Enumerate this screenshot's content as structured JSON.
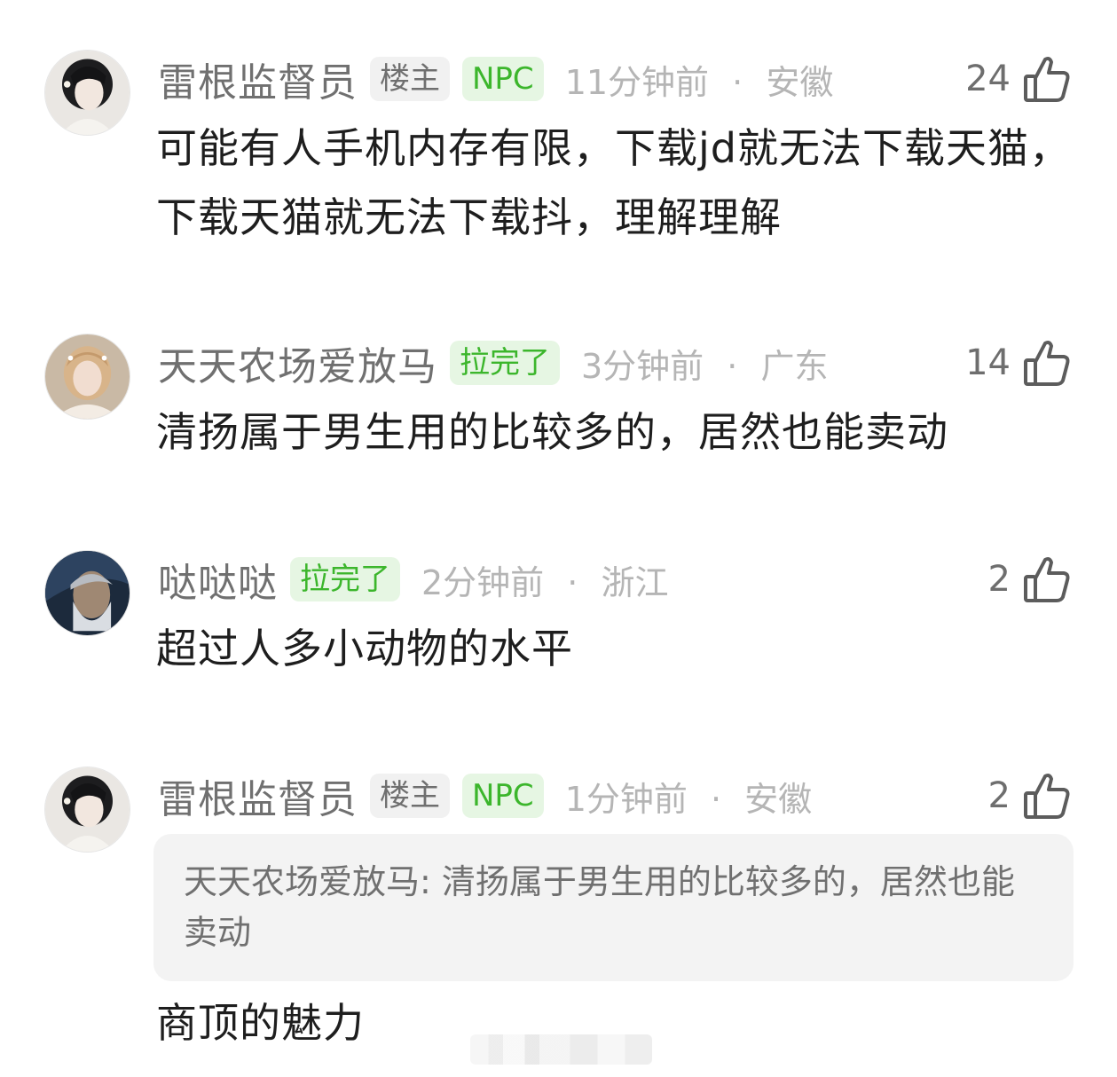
{
  "comments": [
    {
      "username": "雷根监督员",
      "badges": [
        "楼主",
        "NPC"
      ],
      "time": "11分钟前",
      "location": "安徽",
      "likes": "24",
      "text": "可能有人手机内存有限，下载jd就无法下载天猫，下载天猫就无法下载抖，理解理解"
    },
    {
      "username": "天天农场爱放马",
      "badges": [
        "拉完了"
      ],
      "time": "3分钟前",
      "location": "广东",
      "likes": "14",
      "text": "清扬属于男生用的比较多的，居然也能卖动"
    },
    {
      "username": "哒哒哒",
      "badges": [
        "拉完了"
      ],
      "time": "2分钟前",
      "location": "浙江",
      "likes": "2",
      "text": "超过人多小动物的水平"
    },
    {
      "username": "雷根监督员",
      "badges": [
        "楼主",
        "NPC"
      ],
      "time": "1分钟前",
      "location": "安徽",
      "likes": "2",
      "quote": "天天农场爱放马: 清扬属于男生用的比较多的，居然也能卖动",
      "text": "商顶的魅力"
    }
  ],
  "separator": "·",
  "icons": {
    "like": "thumbs-up-icon"
  },
  "colors": {
    "username": "#707070",
    "badge_owner_bg": "#f1f1f1",
    "badge_green_bg": "#e6f6e3",
    "badge_green_text": "#3cb62c",
    "meta": "#b5b5b5",
    "quote_bg": "#f3f3f3"
  }
}
